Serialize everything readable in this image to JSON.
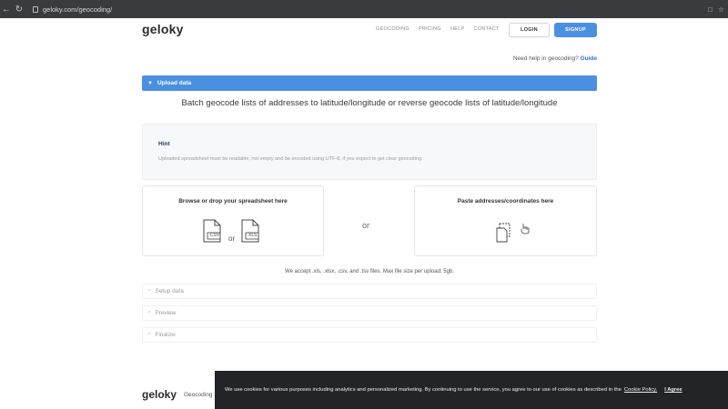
{
  "browser": {
    "url": "geloky.com/geocoding/",
    "back_icon": "back-arrow-icon",
    "reload_icon": "reload-icon"
  },
  "header": {
    "logo": "geloky",
    "nav": [
      "GEOCODING",
      "PRICING",
      "HELP",
      "CONTACT"
    ],
    "login_label": "LOGIN",
    "signup_label": "SIGNUP"
  },
  "help": {
    "prefix": "Need help in geocoding?",
    "link": "Guide"
  },
  "upload": {
    "section_label": "Upload data",
    "headline": "Batch geocode lists of addresses to latitude/longitude or reverse geocode lists of latitude/longitude",
    "hint_title": "Hint",
    "hint_text": "Uploaded spreadsheet must be readable, not empty and be encoded using UTF-8, if you expect to get clear geocoding.",
    "browse_title": "Browse or drop your spreadsheet here",
    "file_label_csv": "CSV",
    "file_label_xls": "XLS",
    "small_or": "or",
    "middle_or": "or",
    "paste_title": "Paste addresses/coordinates here",
    "accepts": "We accept .xls, .xlsx, .csv, and .tsv files. Max file size per upload: 5gb."
  },
  "accordion": [
    "Setup data",
    "Preview",
    "Finalize"
  ],
  "footer": {
    "logo": "geloky",
    "link": "Geocoding"
  },
  "cookie": {
    "text": "We use cookies for various purposes including analytics and personalized marketing. By continuing to use the service, you agree to our use of cookies as described in the",
    "policy_link": "Cookie Policy.",
    "accept": "I Agree"
  },
  "colors": {
    "accent": "#4a90e2",
    "banner": "#222428"
  }
}
